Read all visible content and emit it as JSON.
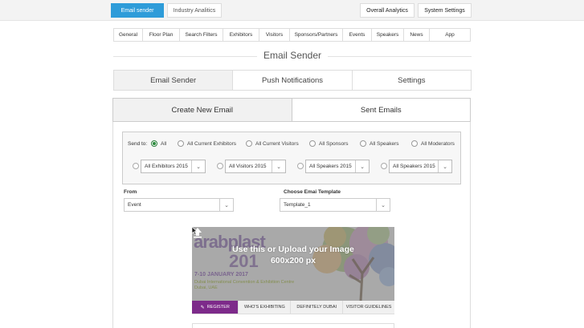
{
  "topbar": {
    "email_sender": "Email sender",
    "industry_analitics": "Industry Analitics",
    "overall_analytics": "Overall Analytics",
    "system_settings": "System Settings"
  },
  "nav": [
    "General",
    "Floor Plan",
    "Search Filters",
    "Exhibitors",
    "Visitors",
    "Sponsors/Partners",
    "Events",
    "Speakers",
    "News",
    "App"
  ],
  "page_title": "Email Sender",
  "tabs1": [
    "Email Sender",
    "Push Notifications",
    "Settings"
  ],
  "tabs2": [
    "Create New Email",
    "Sent Emails"
  ],
  "send_to": {
    "label": "Send to:",
    "options": [
      "All",
      "All Current Exhibitors",
      "All Current Visitors",
      "All Sponsors",
      "All Speakers",
      "All Moderators"
    ],
    "selected": "All"
  },
  "year_selects": [
    "All Exhibitors 2015",
    "All Visitors 2015",
    "All Speakers 2015",
    "All Speakers 2015"
  ],
  "from": {
    "label": "From",
    "value": "Event"
  },
  "template": {
    "label": "Choose Emai Template",
    "value": "Template_1"
  },
  "banner": {
    "logo_text": "arabplast",
    "year_text": "201",
    "upload_line1": "Use this or Upload your Image",
    "upload_line2": "600x200 px",
    "dates": "7-10 JANUARY 2017",
    "venue_line1": "Dubai International Convention & Exhibition Centre",
    "venue_line2": "Dubai, UAE",
    "nav": [
      "REGISTER",
      "WHO'S EXHIBITING",
      "DEFINITELY DUBAI",
      "VISITOR GUIDELINES"
    ]
  },
  "colors": {
    "accent": "#2e9cd9",
    "register": "#7d2a8a",
    "radio_checked": "#2a8a3c"
  },
  "icons": {
    "upload": "upload-arrow-icon",
    "dropdown": "chevron-down-icon",
    "register": "pencil-icon"
  }
}
